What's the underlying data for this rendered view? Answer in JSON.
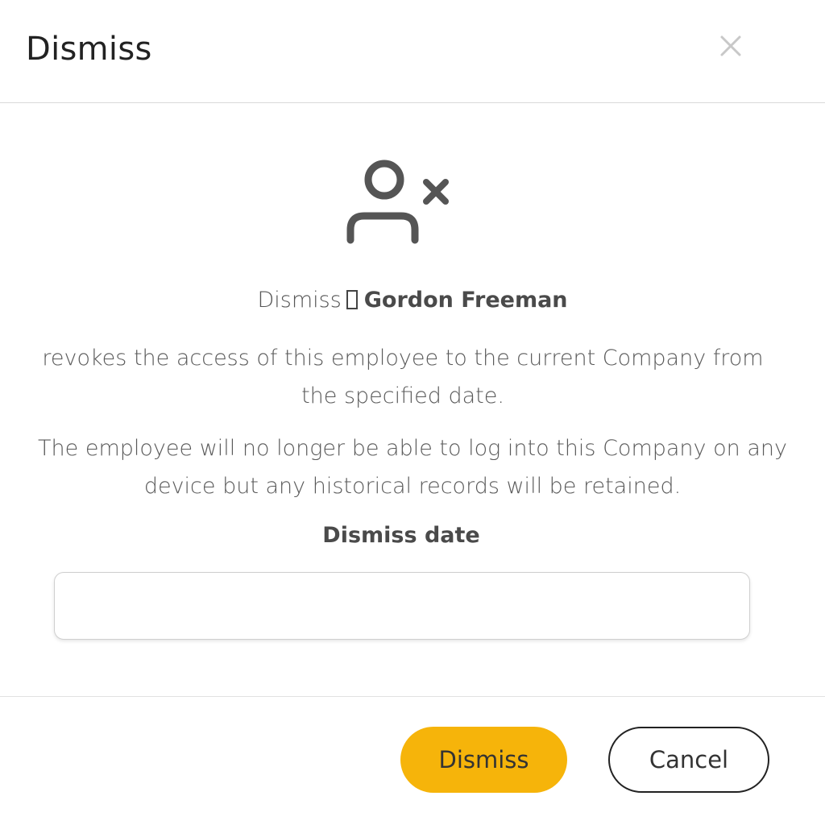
{
  "modal": {
    "title": "Dismiss",
    "close_icon": "close-icon"
  },
  "body": {
    "icon": "user-remove-icon",
    "action_word": "Dismiss",
    "employee_name": "Gordon Freeman",
    "description_1": "revokes the access of this employee to the current Company from the specified date.",
    "description_2": "The employee will no longer be able to log into this Company on any device but any historical records will be retained.",
    "date_label": "Dismiss date",
    "date_value": "",
    "date_placeholder": ""
  },
  "footer": {
    "dismiss_label": "Dismiss",
    "cancel_label": "Cancel"
  },
  "colors": {
    "accent": "#f6b40a",
    "text": "#333333",
    "icon": "#555555"
  }
}
